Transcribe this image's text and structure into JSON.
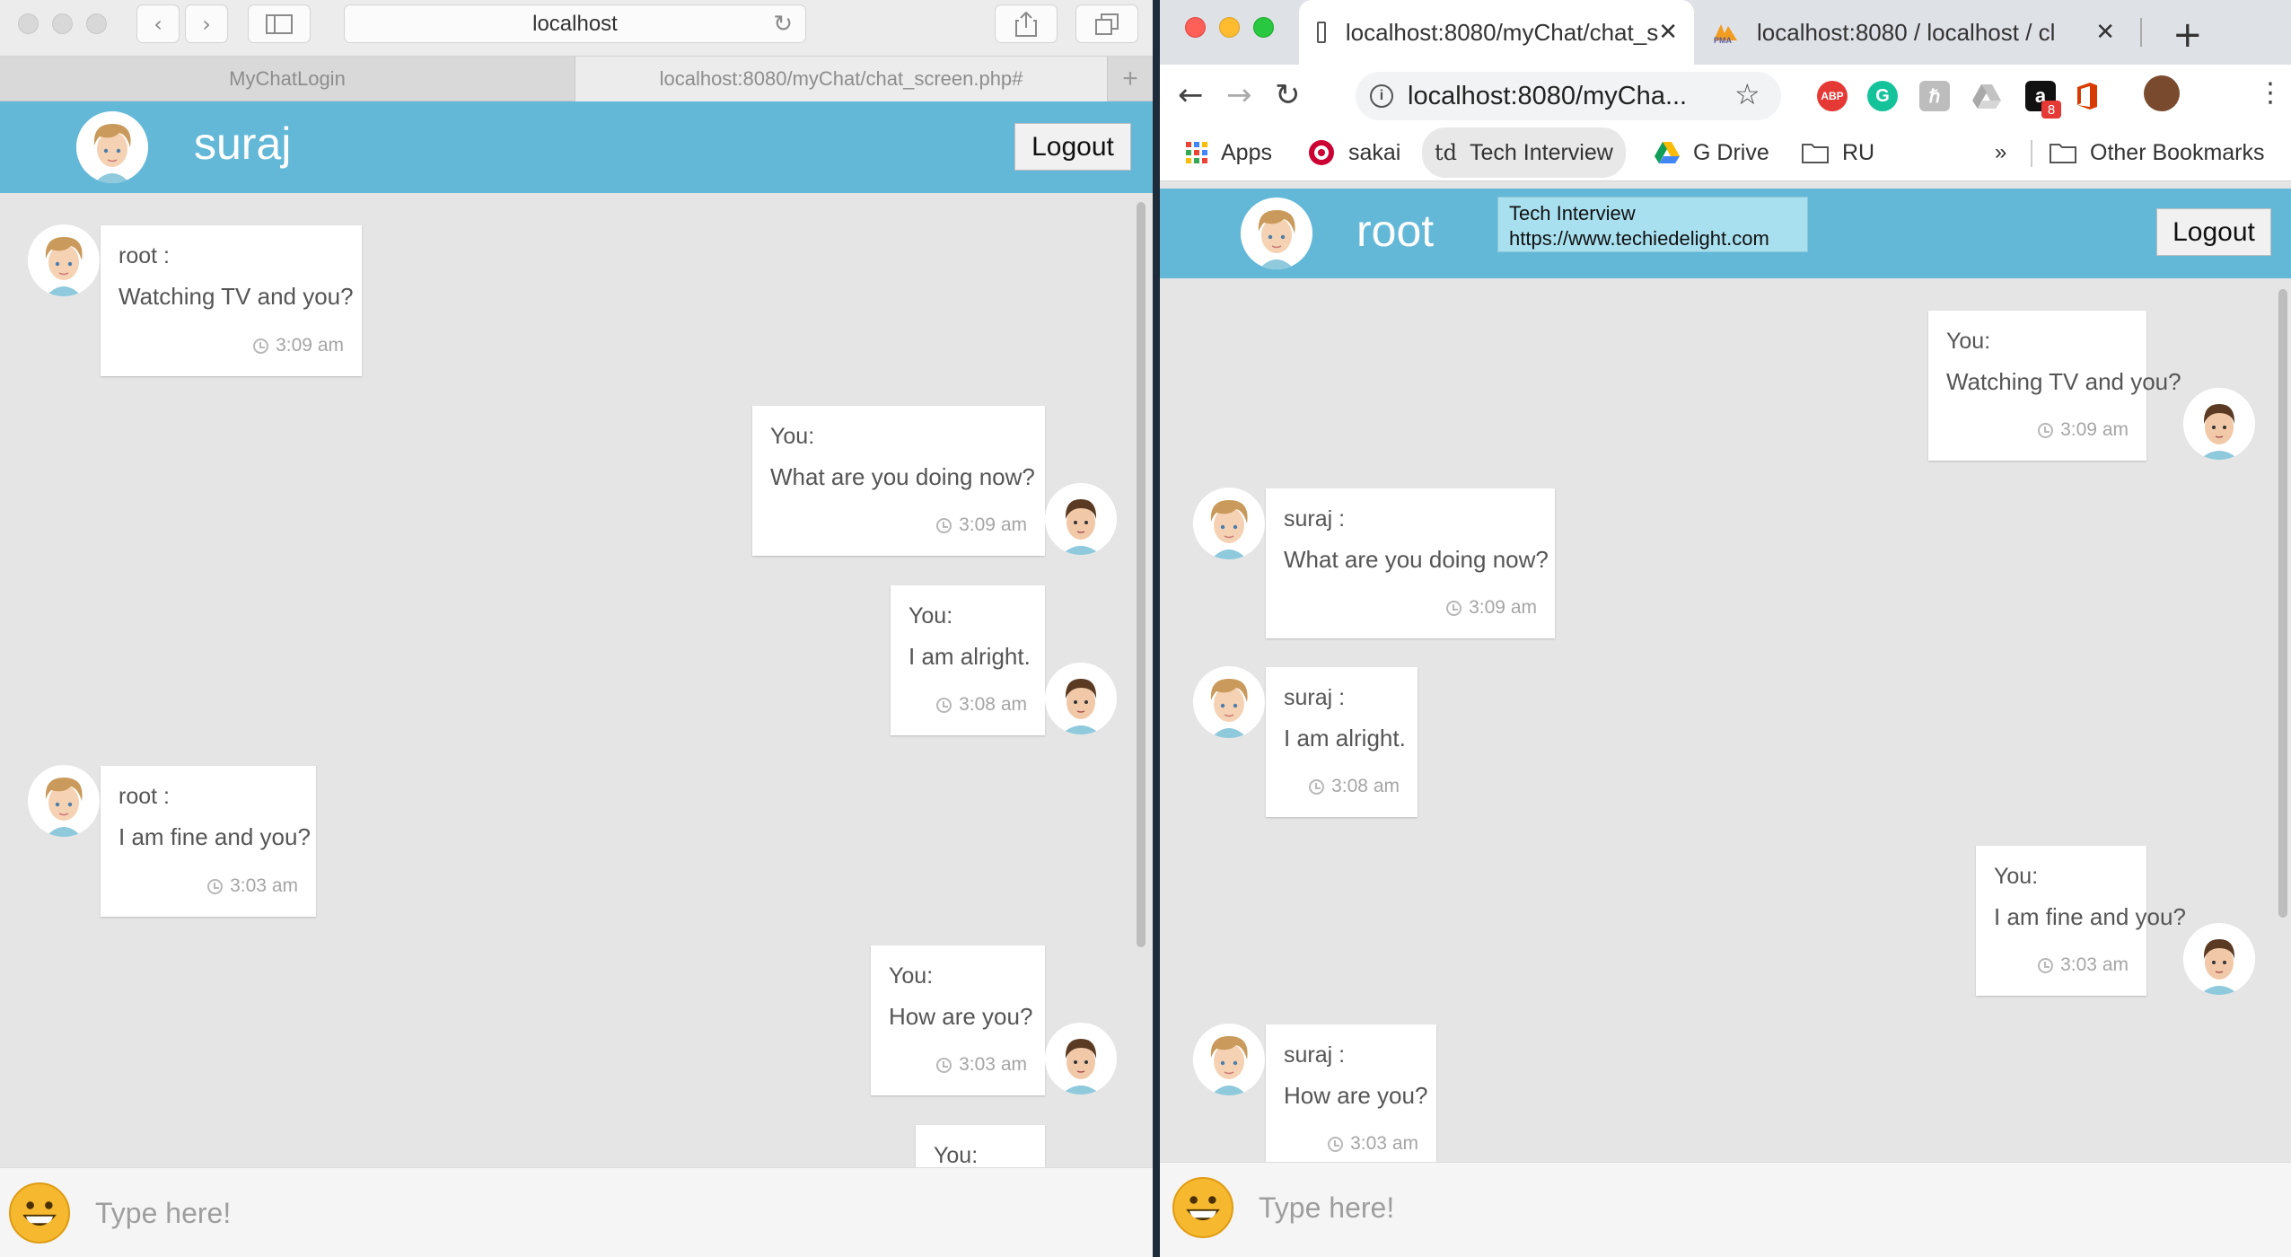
{
  "safari": {
    "url": "localhost",
    "tabs": [
      "MyChatLogin",
      "localhost:8080/myChat/chat_screen.php#"
    ],
    "header": {
      "name": "suraj",
      "logout_label": "Logout"
    },
    "messages": [
      {
        "who": "root :",
        "text": "Watching TV and you?",
        "time": "3:09 am",
        "side": "left"
      },
      {
        "who": "You:",
        "text": "What are you doing now?",
        "time": "3:09 am",
        "side": "right"
      },
      {
        "who": "You:",
        "text": "I am alright.",
        "time": "3:08 am",
        "side": "right"
      },
      {
        "who": "root :",
        "text": "I am fine and you?",
        "time": "3:03 am",
        "side": "left"
      },
      {
        "who": "You:",
        "text": "How are you?",
        "time": "3:03 am",
        "side": "right"
      },
      {
        "who": "You:",
        "text": "",
        "time": "",
        "side": "right"
      }
    ],
    "input_placeholder": "Type here!"
  },
  "chrome": {
    "tabs": [
      {
        "title": "localhost:8080/myChat/chat_s",
        "close": "✕"
      },
      {
        "title": "localhost:8080 / localhost / cl",
        "close": "✕"
      }
    ],
    "new_tab": "+",
    "url": "localhost:8080/myCha...",
    "extensions": {
      "amazon_badge": "8"
    },
    "bookmarks": [
      "Apps",
      "sakai",
      "Tech Interview",
      "G Drive",
      "RU"
    ],
    "bookmarks_more": "»",
    "other_bookmarks": "Other Bookmarks",
    "tooltip": {
      "line1": "Tech Interview",
      "line2": "https://www.techiedelight.com"
    },
    "header": {
      "name": "root",
      "logout_label": "Logout"
    },
    "messages": [
      {
        "who": "You:",
        "text": "Watching TV and you?",
        "time": "3:09 am",
        "side": "right"
      },
      {
        "who": "suraj :",
        "text": "What are you doing now?",
        "time": "3:09 am",
        "side": "left"
      },
      {
        "who": "suraj :",
        "text": "I am alright.",
        "time": "3:08 am",
        "side": "left"
      },
      {
        "who": "You:",
        "text": "I am fine and you?",
        "time": "3:03 am",
        "side": "right"
      },
      {
        "who": "suraj :",
        "text": "How are you?",
        "time": "3:03 am",
        "side": "left"
      }
    ],
    "input_placeholder": "Type here!"
  },
  "colors": {
    "header": "#63b8d8",
    "chat_bg": "#e5e5e5",
    "bubble": "#ffffff",
    "emoji": "#f5b82e"
  }
}
